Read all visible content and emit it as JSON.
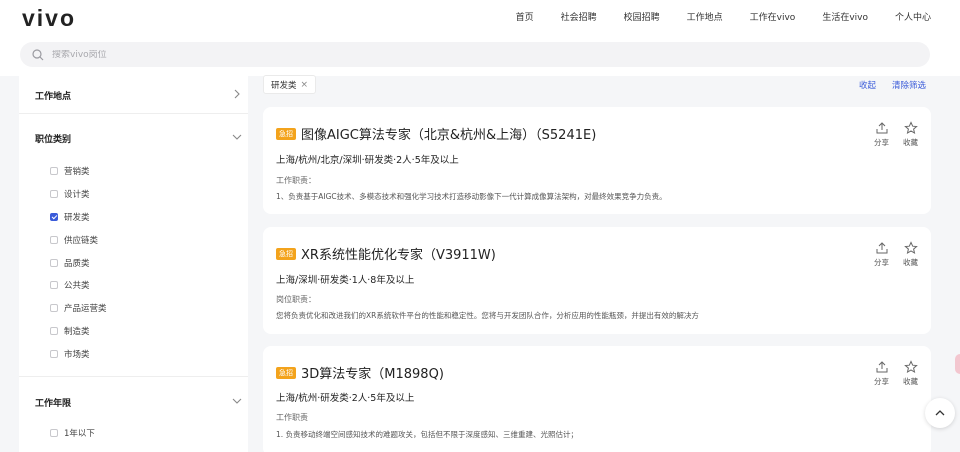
{
  "brand": {
    "logo": "vivo"
  },
  "nav": [
    "首页",
    "社会招聘",
    "校园招聘",
    "工作地点",
    "工作在vivo",
    "生活在vivo",
    "个人中心"
  ],
  "search": {
    "placeholder": "搜索vivo岗位"
  },
  "sidebar": {
    "location": "工作地点",
    "category": "职位类别",
    "categories": [
      {
        "label": "营销类",
        "checked": false
      },
      {
        "label": "设计类",
        "checked": false
      },
      {
        "label": "研发类",
        "checked": true
      },
      {
        "label": "供应链类",
        "checked": false
      },
      {
        "label": "品质类",
        "checked": false
      },
      {
        "label": "公共类",
        "checked": false
      },
      {
        "label": "产品运营类",
        "checked": false
      },
      {
        "label": "制造类",
        "checked": false
      },
      {
        "label": "市场类",
        "checked": false
      }
    ],
    "experience": "工作年限",
    "experience_options": [
      {
        "label": "1年以下",
        "checked": false
      }
    ]
  },
  "filter_tag": "研发类",
  "toplinks": {
    "collapse": "收起",
    "clear": "清除筛选"
  },
  "badge": "急招",
  "share_label": "分享",
  "fav_label": "收藏",
  "jobs": [
    {
      "title": "图像AIGC算法专家（北京&杭州&上海）（S5241E)",
      "meta": "上海/杭州/北京/深圳·研发类·2人·5年及以上",
      "duty_label": "工作职责：",
      "duty": "1、负责基于AIGC技术、多模态技术和强化学习技术打造移动影像下一代计算成像算法架构，对最终效果竞争力负责。"
    },
    {
      "title": "XR系统性能优化专家（V3911W)",
      "meta": "上海/深圳·研发类·1人·8年及以上",
      "duty_label": "岗位职责：",
      "duty": "您将负责优化和改进我们的XR系统软件平台的性能和稳定性。您将与开发团队合作，分析应用的性能瓶颈，并提出有效的解决方"
    },
    {
      "title": "3D算法专家（M1898Q)",
      "meta": "上海/杭州·研发类·2人·5年及以上",
      "duty_label": "工作职责",
      "duty": "1. 负责移动终端空间感知技术的难题攻关，包括但不限于深度感知、三维重建、光照估计；"
    }
  ]
}
